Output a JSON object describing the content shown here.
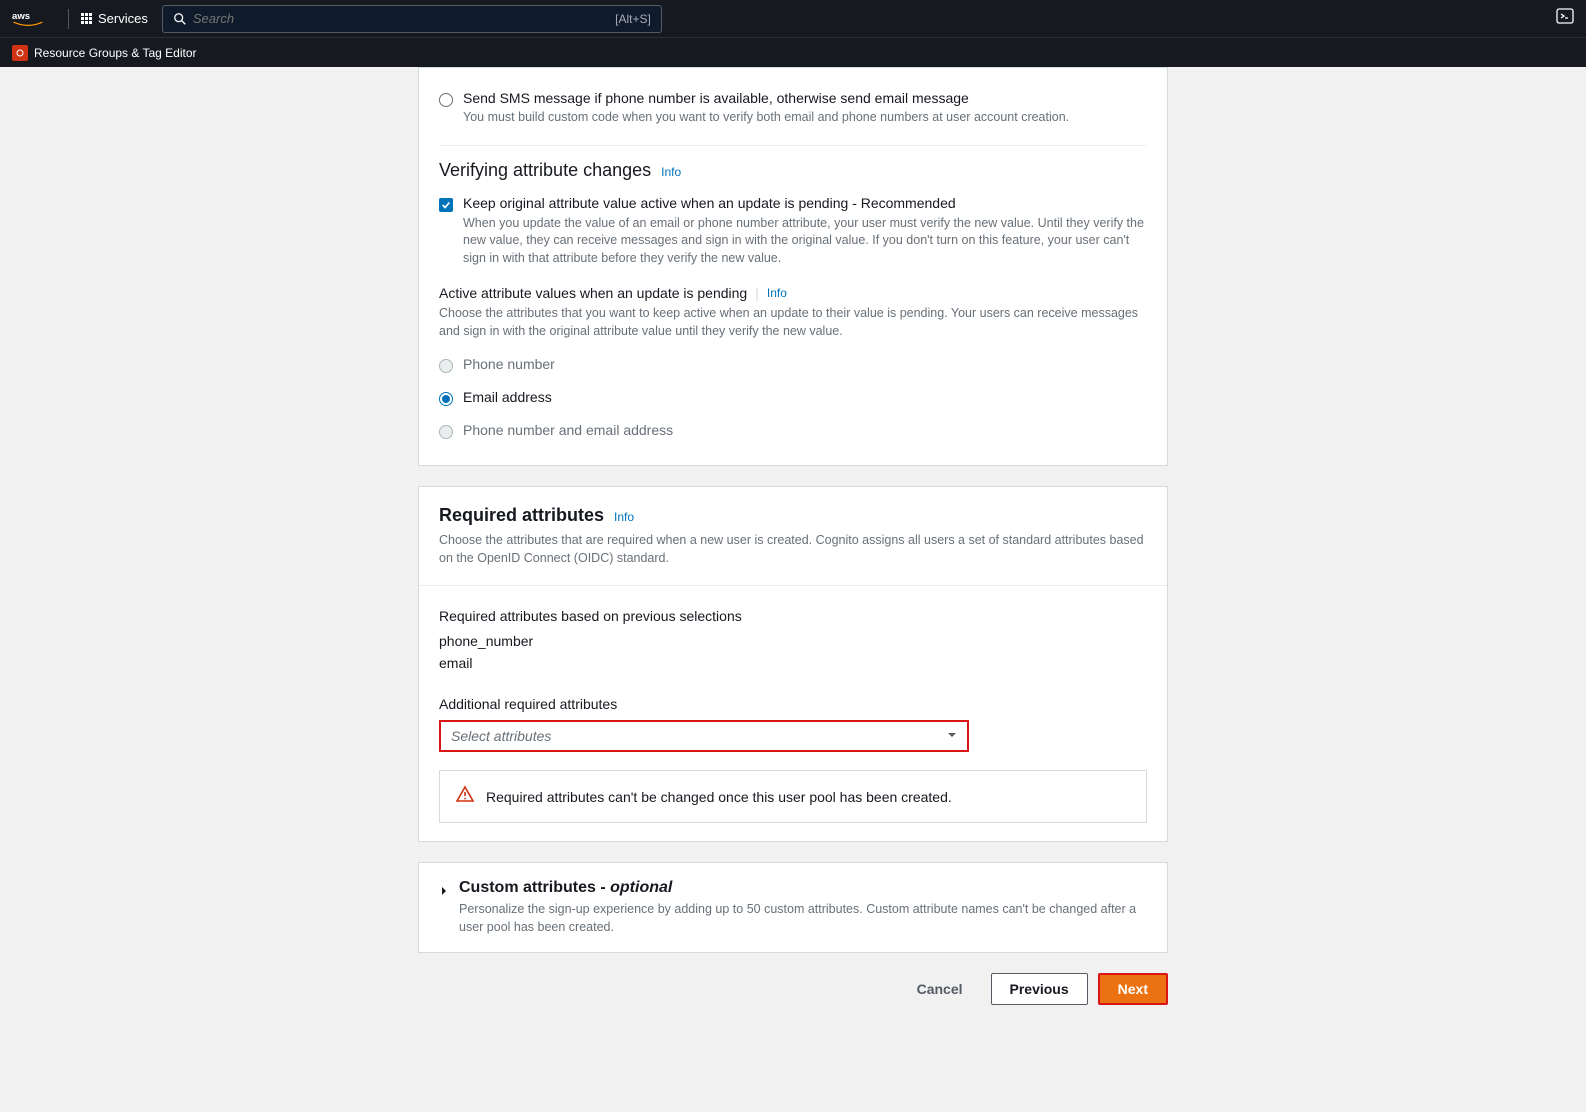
{
  "header": {
    "services": "Services",
    "search_placeholder": "Search",
    "search_shortcut": "[Alt+S]",
    "rg_label": "Resource Groups & Tag Editor"
  },
  "sms_option": {
    "label": "Send SMS message if phone number is available, otherwise send email message",
    "desc": "You must build custom code when you want to verify both email and phone numbers at user account creation."
  },
  "verifying": {
    "title": "Verifying attribute changes",
    "info": "Info",
    "check_label": "Keep original attribute value active when an update is pending - Recommended",
    "check_desc": "When you update the value of an email or phone number attribute, your user must verify the new value. Until they verify the new value, they can receive messages and sign in with the original value. If you don't turn on this feature, your user can't sign in with that attribute before they verify the new value.",
    "active_label": "Active attribute values when an update is pending",
    "active_info": "Info",
    "active_desc": "Choose the attributes that you want to keep active when an update to their value is pending. Your users can receive messages and sign in with the original attribute value until they verify the new value.",
    "opt_phone": "Phone number",
    "opt_email": "Email address",
    "opt_both": "Phone number and email address"
  },
  "required": {
    "title": "Required attributes",
    "info": "Info",
    "desc": "Choose the attributes that are required when a new user is created. Cognito assigns all users a set of standard attributes based on the OpenID Connect (OIDC) standard.",
    "prev_label": "Required attributes based on previous selections",
    "prev_values": [
      "phone_number",
      "email"
    ],
    "additional_label": "Additional required attributes",
    "select_placeholder": "Select attributes",
    "warning": "Required attributes can't be changed once this user pool has been created."
  },
  "custom": {
    "title": "Custom attributes - ",
    "optional": "optional",
    "desc": "Personalize the sign-up experience by adding up to 50 custom attributes. Custom attribute names can't be changed after a user pool has been created."
  },
  "buttons": {
    "cancel": "Cancel",
    "previous": "Previous",
    "next": "Next"
  }
}
